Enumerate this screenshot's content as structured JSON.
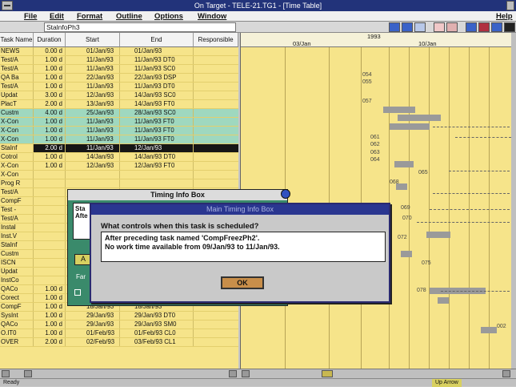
{
  "window": {
    "title": "On Target - TELE-21.TG1 - [Time Table]"
  },
  "menu": {
    "items": [
      "File",
      "Edit",
      "Format",
      "Outline",
      "Options",
      "Window"
    ],
    "help": "Help"
  },
  "toolbar": {
    "edit_value": "StalnfoPh3"
  },
  "grid": {
    "headers": [
      "Task Name",
      "Duration",
      "Start",
      "End",
      "Responsible"
    ],
    "rows": [
      {
        "name": "NEWS",
        "dur": "0.00 d",
        "start": "01/Jan/93",
        "end": "01/Jan/93",
        "style": ""
      },
      {
        "name": "Test/A",
        "dur": "1.00 d",
        "start": "11/Jan/93",
        "end": "11/Jan/93 DT0",
        "style": ""
      },
      {
        "name": "Test/A",
        "dur": "1.00 d",
        "start": "11/Jan/93",
        "end": "11/Jan/93 SC0",
        "style": ""
      },
      {
        "name": "QA Ba",
        "dur": "1.00 d",
        "start": "22/Jan/93",
        "end": "22/Jan/93 DSP",
        "style": ""
      },
      {
        "name": "Test/A",
        "dur": "1.00 d",
        "start": "11/Jan/93",
        "end": "11/Jan/93 DT0",
        "style": ""
      },
      {
        "name": "Updat",
        "dur": "3.00 d",
        "start": "12/Jan/93",
        "end": "14/Jan/93 SC0",
        "style": ""
      },
      {
        "name": "PlacT",
        "dur": "2.00 d",
        "start": "13/Jan/93",
        "end": "14/Jan/93 FT0",
        "style": ""
      },
      {
        "name": "Custm",
        "dur": "4.00 d",
        "start": "25/Jan/93",
        "end": "28/Jan/93 SC0",
        "style": "teal"
      },
      {
        "name": "X-Con",
        "dur": "1.00 d",
        "start": "11/Jan/93",
        "end": "11/Jan/93 FT0",
        "style": "teal"
      },
      {
        "name": "X-Con",
        "dur": "1.00 d",
        "start": "11/Jan/93",
        "end": "11/Jan/93 FT0",
        "style": "teal"
      },
      {
        "name": "X-Con",
        "dur": "1.00 d",
        "start": "11/Jan/93",
        "end": "11/Jan/93 FT0",
        "style": "teal"
      },
      {
        "name": "StaInf",
        "dur": "2.00 d",
        "start": "11/Jan/93",
        "end": "12/Jan/93",
        "style": "sel"
      },
      {
        "name": "Cotrol",
        "dur": "1.00 d",
        "start": "14/Jan/93",
        "end": "14/Jan/93 DT0",
        "style": ""
      },
      {
        "name": "X-Con",
        "dur": "1.00 d",
        "start": "12/Jan/93",
        "end": "12/Jan/93 FT0",
        "style": ""
      },
      {
        "name": "X-Con",
        "dur": "",
        "start": "",
        "end": "",
        "style": ""
      },
      {
        "name": "Prog R",
        "dur": "",
        "start": "",
        "end": "",
        "style": ""
      },
      {
        "name": "Test/A",
        "dur": "",
        "start": "",
        "end": "",
        "style": ""
      },
      {
        "name": "CompF",
        "dur": "",
        "start": "",
        "end": "",
        "style": ""
      },
      {
        "name": "Test -",
        "dur": "",
        "start": "",
        "end": "",
        "style": ""
      },
      {
        "name": "Test/A",
        "dur": "",
        "start": "",
        "end": "",
        "style": ""
      },
      {
        "name": "Instal",
        "dur": "",
        "start": "",
        "end": "",
        "style": ""
      },
      {
        "name": "Inst.V",
        "dur": "",
        "start": "",
        "end": "",
        "style": ""
      },
      {
        "name": "StaInf",
        "dur": "",
        "start": "",
        "end": "",
        "style": ""
      },
      {
        "name": "Custm",
        "dur": "",
        "start": "",
        "end": "",
        "style": ""
      },
      {
        "name": "ISCN",
        "dur": "",
        "start": "",
        "end": "",
        "style": ""
      },
      {
        "name": "Updat",
        "dur": "",
        "start": "",
        "end": "",
        "style": ""
      },
      {
        "name": "InstCo",
        "dur": "",
        "start": "",
        "end": "",
        "style": ""
      },
      {
        "name": "QACo",
        "dur": "1.00 d",
        "start": "20/Jan/93",
        "end": "20/Jan/93 SC0",
        "style": ""
      },
      {
        "name": "Corect",
        "dur": "1.00 d",
        "start": "21/Jan/93",
        "end": "21/Jan/93 DT0",
        "style": ""
      },
      {
        "name": "CompF",
        "dur": "1.00 d",
        "start": "18/Jan/93",
        "end": "18/Jan/93",
        "style": ""
      },
      {
        "name": "SysInt",
        "dur": "1.00 d",
        "start": "29/Jan/93",
        "end": "29/Jan/93 DT0",
        "style": ""
      },
      {
        "name": "QACo",
        "dur": "1.00 d",
        "start": "29/Jan/93",
        "end": "29/Jan/93 SM0",
        "style": ""
      },
      {
        "name": "O.IT0",
        "dur": "1.00 d",
        "start": "01/Feb/93",
        "end": "01/Feb/93 CL0",
        "style": ""
      },
      {
        "name": "OVER",
        "dur": "2.00 d",
        "start": "02/Feb/93",
        "end": "03/Feb/93 CL1",
        "style": ""
      }
    ]
  },
  "gantt": {
    "year": "1993",
    "weeks": [
      "03/Jan",
      "10/Jan"
    ],
    "labels": [
      "054",
      "055",
      "057",
      "061",
      "062",
      "063",
      "064",
      "065",
      "068",
      "069",
      "070",
      "072",
      "075",
      "078",
      "002"
    ]
  },
  "timing_box": {
    "title": "Timing Info Box",
    "frag1": "Sta",
    "frag2": "Afte",
    "frag3": "A",
    "frag4": "Far"
  },
  "main_timing_box": {
    "title": "Main Timing Info Box",
    "question": "What controls when this task is scheduled?",
    "answer_line1": "After preceding task named 'CompFreezPh2'.",
    "answer_line2": "No work time available from 09/Jan/93 to 11/Jan/93.",
    "ok_label": "OK"
  },
  "status": {
    "left": "Ready",
    "right": "Up Arrow"
  },
  "colors": {
    "grid_bg": "#f6e48a",
    "teal_row": "#9fd8bf",
    "title_bar": "#22337a",
    "dialog_green": "#3a8a6b",
    "ok_button": "#c88e4a"
  }
}
